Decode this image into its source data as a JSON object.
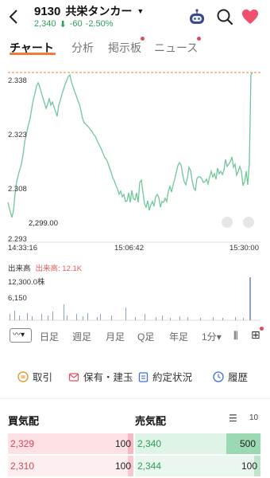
{
  "header": {
    "code": "9130",
    "name": "共栄タンカー",
    "price": "2,340",
    "change": "-60",
    "change_pct": "-2.50%"
  },
  "tabs": [
    {
      "label": "チャート",
      "active": true,
      "dot": false
    },
    {
      "label": "分析",
      "active": false,
      "dot": false
    },
    {
      "label": "掲示板",
      "active": false,
      "dot": true
    },
    {
      "label": "ニュース",
      "active": false,
      "dot": true
    }
  ],
  "chart": {
    "y_labels": [
      "2.338",
      "2.323",
      "2.308",
      "2.293"
    ],
    "x_labels": [
      "14:33:16",
      "15:06:42",
      "15:30:00"
    ],
    "min_label": "2,299.00"
  },
  "volume": {
    "title": "出来高",
    "current": "出来高: 12.1K",
    "max": "12,300.0株",
    "mid": "6,150"
  },
  "toolbar": {
    "items": [
      "日足",
      "週足",
      "月足",
      "Q足",
      "年足",
      "1分"
    ]
  },
  "actions": [
    {
      "label": "取引",
      "icon": "trade-icon"
    },
    {
      "label": "保有・建玉",
      "icon": "portfolio-icon"
    },
    {
      "label": "約定状況",
      "icon": "clipboard-icon"
    },
    {
      "label": "履歴",
      "icon": "clock-icon"
    }
  ],
  "board": {
    "bid_title": "買気配",
    "ask_title": "売気配",
    "depth": "10",
    "rows": [
      {
        "bid_price": "2,329",
        "bid_qty": "100",
        "ask_price": "2,340",
        "ask_qty": "500"
      },
      {
        "bid_price": "2,310",
        "bid_qty": "100",
        "ask_price": "2,344",
        "ask_qty": "100"
      }
    ]
  },
  "colors": {
    "up": "#2aa05a",
    "line": "#6fc79a",
    "accent": "#f07b3a",
    "like": "#f0506e",
    "bid_bg": "#fde1e4",
    "ask_bg": "#dff3e6"
  }
}
